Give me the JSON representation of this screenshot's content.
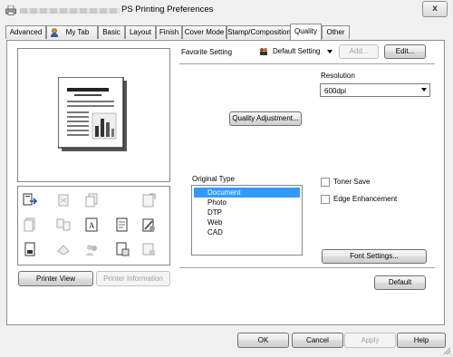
{
  "window": {
    "title": "PS Printing Preferences",
    "close_glyph": "x"
  },
  "tabs": [
    "Advanced",
    "My Tab",
    "Basic",
    "Layout",
    "Finish",
    "Cover Mode",
    "Stamp/Composition",
    "Quality",
    "Other"
  ],
  "active_tab": "Quality",
  "favorite": {
    "label": "Favorite Setting",
    "value": "Default Setting",
    "add_label": "Add...",
    "edit_label": "Edit..."
  },
  "left": {
    "printer_view_label": "Printer View",
    "printer_info_label": "Printer Information"
  },
  "quality": {
    "adjust_label": "Quality Adjustment...",
    "resolution_label": "Resolution",
    "resolution_value": "600dpi",
    "original_type_label": "Original Type",
    "original_types": [
      "Document",
      "Photo",
      "DTP",
      "Web",
      "CAD"
    ],
    "selected_original_type": "Document",
    "toner_save_label": "Toner Save",
    "toner_save_checked": false,
    "edge_enhancement_label": "Edge Enhancement",
    "edge_enhancement_checked": false,
    "font_settings_label": "Font Settings...",
    "default_label": "Default"
  },
  "footer": {
    "ok_label": "OK",
    "cancel_label": "Cancel",
    "apply_label": "Apply",
    "help_label": "Help"
  },
  "colors": {
    "selection": "#3399ff",
    "tab_border": "#8e8f8f"
  }
}
